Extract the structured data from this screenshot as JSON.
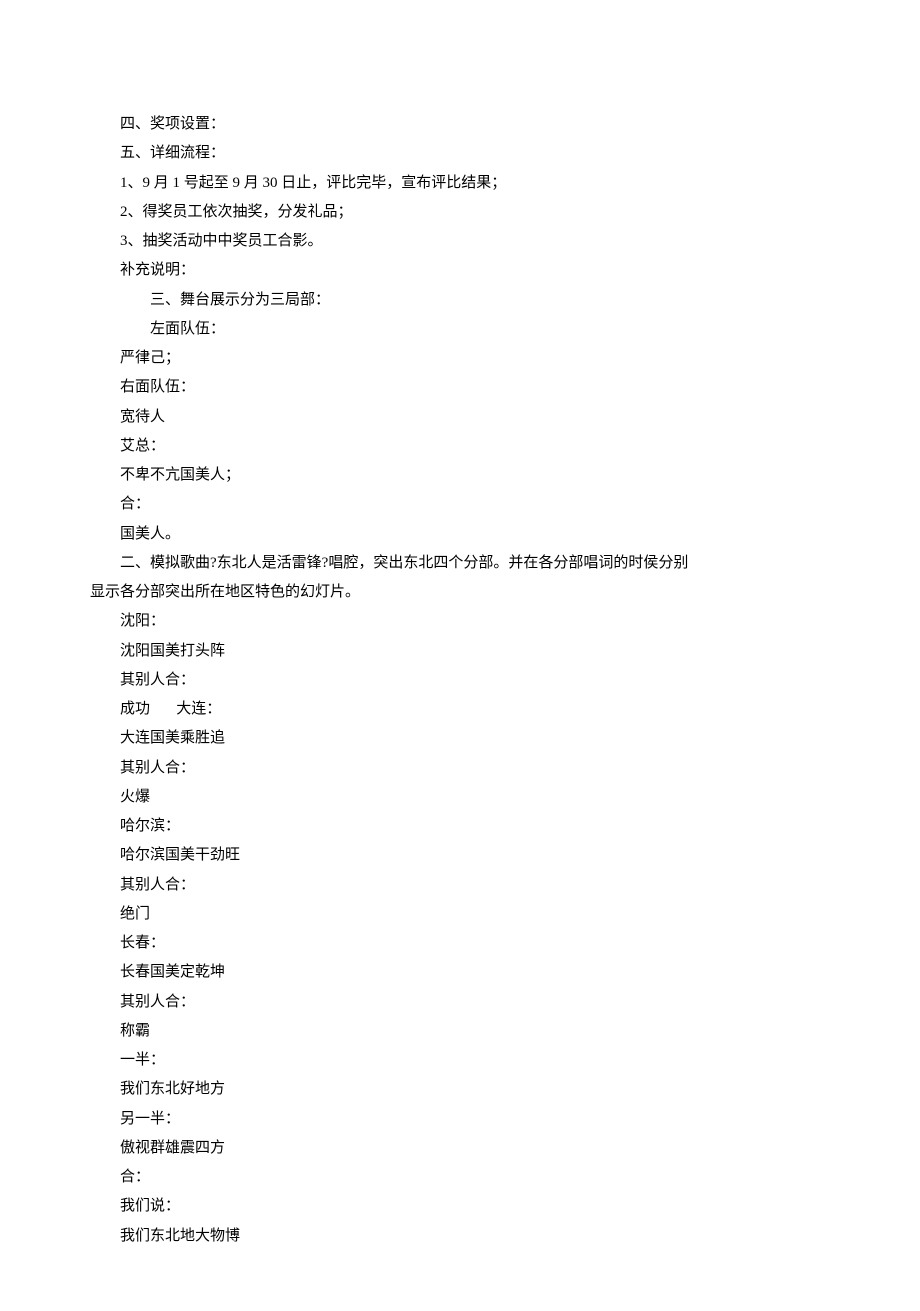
{
  "lines": [
    {
      "cls": "line",
      "text": "四、奖项设置："
    },
    {
      "cls": "line",
      "text": "五、详细流程："
    },
    {
      "cls": "line",
      "text": "1、9 月 1 号起至 9 月 30 日止，评比完毕，宣布评比结果；"
    },
    {
      "cls": "line",
      "text": "2、得奖员工依次抽奖，分发礼品；"
    },
    {
      "cls": "line",
      "text": "3、抽奖活动中中奖员工合影。"
    },
    {
      "cls": "line",
      "text": "补充说明："
    },
    {
      "cls": "line indent2",
      "text": "三、舞台展示分为三局部："
    },
    {
      "cls": "line indent2",
      "text": "左面队伍："
    },
    {
      "cls": "line",
      "text": "严律己；"
    },
    {
      "cls": "line",
      "text": "右面队伍："
    },
    {
      "cls": "line",
      "text": "宽待人"
    },
    {
      "cls": "line",
      "text": "艾总："
    },
    {
      "cls": "line",
      "text": "不卑不亢国美人；"
    },
    {
      "cls": "line",
      "text": "合："
    },
    {
      "cls": "line",
      "text": "国美人。"
    },
    {
      "cls": "line",
      "text": "二、模拟歌曲?东北人是活雷锋?唱腔，突出东北四个分部。并在各分部唱词的时侯分别"
    },
    {
      "cls": "line noindent",
      "text": "显示各分部突出所在地区特色的幻灯片。"
    },
    {
      "cls": "line",
      "text": "沈阳："
    },
    {
      "cls": "line",
      "text": "沈阳国美打头阵"
    },
    {
      "cls": "line",
      "text": "其别人合："
    },
    {
      "cls": "line",
      "text": "成功       大连："
    },
    {
      "cls": "line",
      "text": "大连国美乘胜追"
    },
    {
      "cls": "line",
      "text": "其别人合："
    },
    {
      "cls": "line",
      "text": "火爆"
    },
    {
      "cls": "line",
      "text": "哈尔滨："
    },
    {
      "cls": "line",
      "text": "哈尔滨国美干劲旺"
    },
    {
      "cls": "line",
      "text": "其别人合："
    },
    {
      "cls": "line",
      "text": "绝门"
    },
    {
      "cls": "line",
      "text": "长春："
    },
    {
      "cls": "line",
      "text": "长春国美定乾坤"
    },
    {
      "cls": "line",
      "text": "其别人合："
    },
    {
      "cls": "line",
      "text": "称霸"
    },
    {
      "cls": "line",
      "text": "一半："
    },
    {
      "cls": "line",
      "text": "我们东北好地方"
    },
    {
      "cls": "line",
      "text": "另一半："
    },
    {
      "cls": "line",
      "text": "傲视群雄震四方"
    },
    {
      "cls": "line",
      "text": "合："
    },
    {
      "cls": "line",
      "text": "我们说："
    },
    {
      "cls": "line",
      "text": "我们东北地大物博"
    }
  ]
}
